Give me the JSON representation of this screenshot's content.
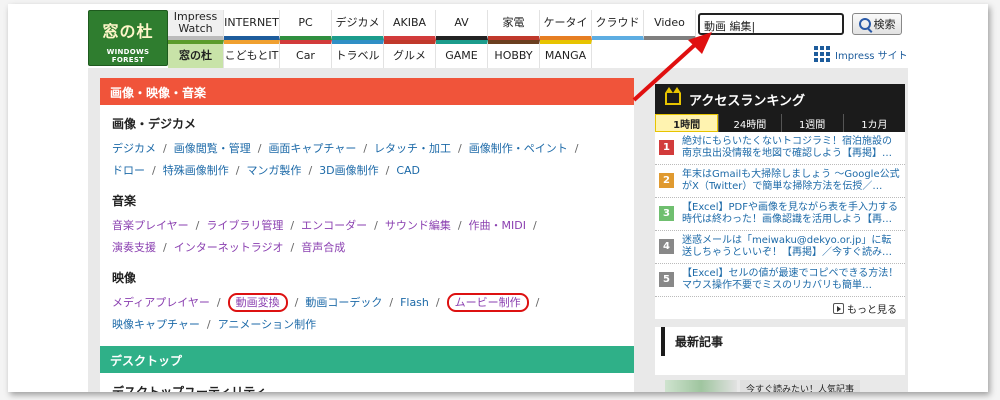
{
  "logo": {
    "title": "窓の杜",
    "subtitle": "WINDOWS FOREST"
  },
  "nav_top": [
    {
      "label": "Impress Watch",
      "color": "#bbbbbb"
    },
    {
      "label": "INTERNET",
      "color": "#1d5c9c"
    },
    {
      "label": "PC",
      "color": "#2f8f3f"
    },
    {
      "label": "デジカメ",
      "color": "#1c9c8c"
    },
    {
      "label": "AKIBA",
      "color": "#d23b3b"
    },
    {
      "label": "AV",
      "color": "#222222"
    },
    {
      "label": "家電",
      "color": "#c0392b"
    },
    {
      "label": "ケータイ",
      "color": "#e67e22"
    },
    {
      "label": "クラウド",
      "color": "#5dade2"
    },
    {
      "label": "Video",
      "color": "#7f7f7f"
    }
  ],
  "nav_bottom": [
    {
      "label": "窓の杜",
      "color": "#5a9c2a"
    },
    {
      "label": "こどもとIT",
      "color": "#f0a030"
    },
    {
      "label": "Car",
      "color": "#d23b3b"
    },
    {
      "label": "トラベル",
      "color": "#2f8fc6"
    },
    {
      "label": "グルメ",
      "color": "#c0392b"
    },
    {
      "label": "GAME",
      "color": "#1c9c8c"
    },
    {
      "label": "HOBBY",
      "color": "#6b3f1f"
    },
    {
      "label": "MANGA",
      "color": "#e7c400"
    }
  ],
  "search": {
    "value": "動画 編集|",
    "button_label": "検索"
  },
  "impress_site": "Impress サイト",
  "section_image": {
    "title": "画像・映像・音楽",
    "categories": [
      {
        "title": "画像・デジカメ",
        "style": "blue",
        "lines": [
          [
            "デジカメ",
            "画像閲覧・管理",
            "画面キャプチャー",
            "レタッチ・加工",
            "画像制作・ペイント",
            ""
          ],
          [
            "ドロー",
            "特殊画像制作",
            "マンガ製作",
            "3D画像制作",
            "CAD"
          ]
        ]
      },
      {
        "title": "音楽",
        "style": "purple",
        "lines": [
          [
            "音楽プレイヤー",
            "ライブラリ管理",
            "エンコーダー",
            "サウンド編集",
            "作曲・MIDI",
            ""
          ],
          [
            "演奏支援",
            "インターネットラジオ",
            "音声合成"
          ]
        ]
      },
      {
        "title": "映像",
        "style": "purple",
        "lines": [
          [
            "メディアプレイヤー",
            "動画変換",
            "動画コーデック",
            "Flash",
            "ムービー制作",
            ""
          ],
          [
            "映像キャプチャー",
            "アニメーション制作"
          ]
        ]
      }
    ]
  },
  "section_desktop": {
    "title": "デスクトップ",
    "first_category": "デスクトップユーティリティ"
  },
  "ranking": {
    "title": "アクセスランキング",
    "tabs": [
      "1時間",
      "24時間",
      "1週間",
      "1カ月"
    ],
    "items": [
      {
        "num": "1",
        "color": "#d23b3b",
        "text": "絶対にもらいたくないトコジラミ！宿泊施設の南京虫出没情報を地図で確認しよう【再掲】…"
      },
      {
        "num": "2",
        "color": "#e09a30",
        "text": "年末はGmailも大掃除しましょう ～Google公式がX（Twitter）で簡単な掃除方法を伝授／…"
      },
      {
        "num": "3",
        "color": "#6fbf6f",
        "text": "【Excel】PDFや画像を見ながら表を手入力する時代は終わった！画像認識を活用しよう【再…"
      },
      {
        "num": "4",
        "color": "#888888",
        "text": "迷惑メールは「meiwaku@dekyo.or.jp」に転送しちゃうといいぞ！【再掲】／今すぐ読み…"
      },
      {
        "num": "5",
        "color": "#888888",
        "text": "【Excel】セルの値が最速でコピペできる方法！マウス操作不要でミスのリカバリも簡単…"
      }
    ],
    "more_label": "もっと見る"
  },
  "latest": {
    "title": "最新記事",
    "tag": "今すぐ読みたい！人気記事"
  }
}
